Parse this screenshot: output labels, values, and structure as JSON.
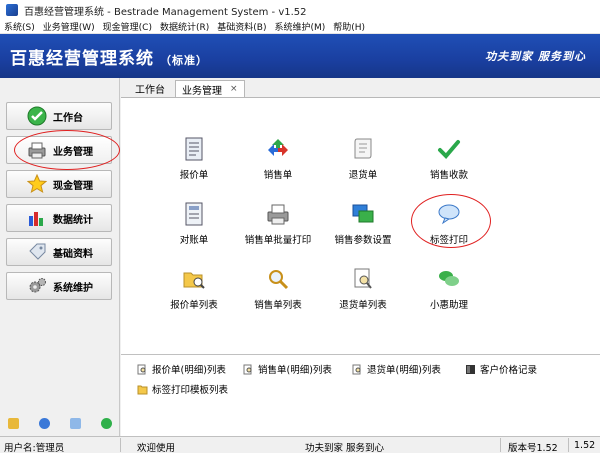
{
  "window": {
    "title": "百惠经营管理系统 - Bestrade Management System - v1.52"
  },
  "menu": [
    {
      "label": "系统(S)"
    },
    {
      "label": "业务管理(W)"
    },
    {
      "label": "现金管理(C)"
    },
    {
      "label": "数据统计(R)"
    },
    {
      "label": "基础资料(B)"
    },
    {
      "label": "系统维护(M)"
    },
    {
      "label": "帮助(H)"
    }
  ],
  "banner": {
    "brand": "百惠经营管理系统",
    "edition": "（标准）",
    "slogan": "功夫到家  服务到心"
  },
  "sidebar": {
    "items": [
      {
        "label": "工作台",
        "icon": "check-icon"
      },
      {
        "label": "业务管理",
        "icon": "printer-icon"
      },
      {
        "label": "现金管理",
        "icon": "star-icon"
      },
      {
        "label": "数据统计",
        "icon": "bar-chart-icon"
      },
      {
        "label": "基础资料",
        "icon": "tag-icon"
      },
      {
        "label": "系统维护",
        "icon": "gears-icon"
      }
    ]
  },
  "tabs": [
    {
      "label": "工作台"
    },
    {
      "label": "业务管理",
      "close": "×"
    }
  ],
  "grid": [
    {
      "label": "报价单",
      "icon": "document-icon"
    },
    {
      "label": "销售单",
      "icon": "recycle-icon"
    },
    {
      "label": "退货单",
      "icon": "scroll-icon"
    },
    {
      "label": "销售收款",
      "icon": "checkmark-icon"
    },
    {
      "label": "对账单",
      "icon": "ledger-icon"
    },
    {
      "label": "销售单批量打印",
      "icon": "printer-icon"
    },
    {
      "label": "销售参数设置",
      "icon": "windows-icon"
    },
    {
      "label": "标签打印",
      "icon": "speech-bubble-icon"
    },
    {
      "label": "报价单列表",
      "icon": "folder-search-icon"
    },
    {
      "label": "销售单列表",
      "icon": "magnifier-icon"
    },
    {
      "label": "退货单列表",
      "icon": "page-search-icon"
    },
    {
      "label": "小惠助理",
      "icon": "chat-icon"
    }
  ],
  "links": [
    {
      "label": "报价单(明细)列表",
      "icon": "page-search-icon"
    },
    {
      "label": "销售单(明细)列表",
      "icon": "page-search-icon"
    },
    {
      "label": "退货单(明细)列表",
      "icon": "page-search-icon"
    },
    {
      "label": "客户价格记录",
      "icon": "book-icon"
    },
    {
      "label": "标签打印模板列表",
      "icon": "folder-icon"
    }
  ],
  "status": {
    "user": "用户名:管理员",
    "welcome": "欢迎使用",
    "slogan": "功夫到家 服务到心",
    "version_label": "版本号1.52",
    "version_short": "1.52"
  }
}
